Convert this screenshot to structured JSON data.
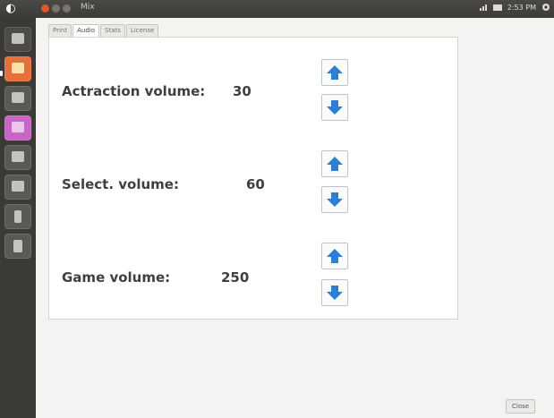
{
  "panel": {
    "app_title": "Mix",
    "clock": "2:53 PM"
  },
  "tabs": [
    {
      "label": "Print"
    },
    {
      "label": "Audio"
    },
    {
      "label": "Stats"
    },
    {
      "label": "License"
    }
  ],
  "settings": [
    {
      "label": "Actraction volume:",
      "value": "30"
    },
    {
      "label": "Select. volume:",
      "value": "60"
    },
    {
      "label": "Game volume:",
      "value": "250"
    }
  ],
  "close_label": "Close",
  "colors": {
    "launcher": "#3c3a36",
    "top_panel": "#3c3b37",
    "arrow": "#2b7fd4"
  }
}
